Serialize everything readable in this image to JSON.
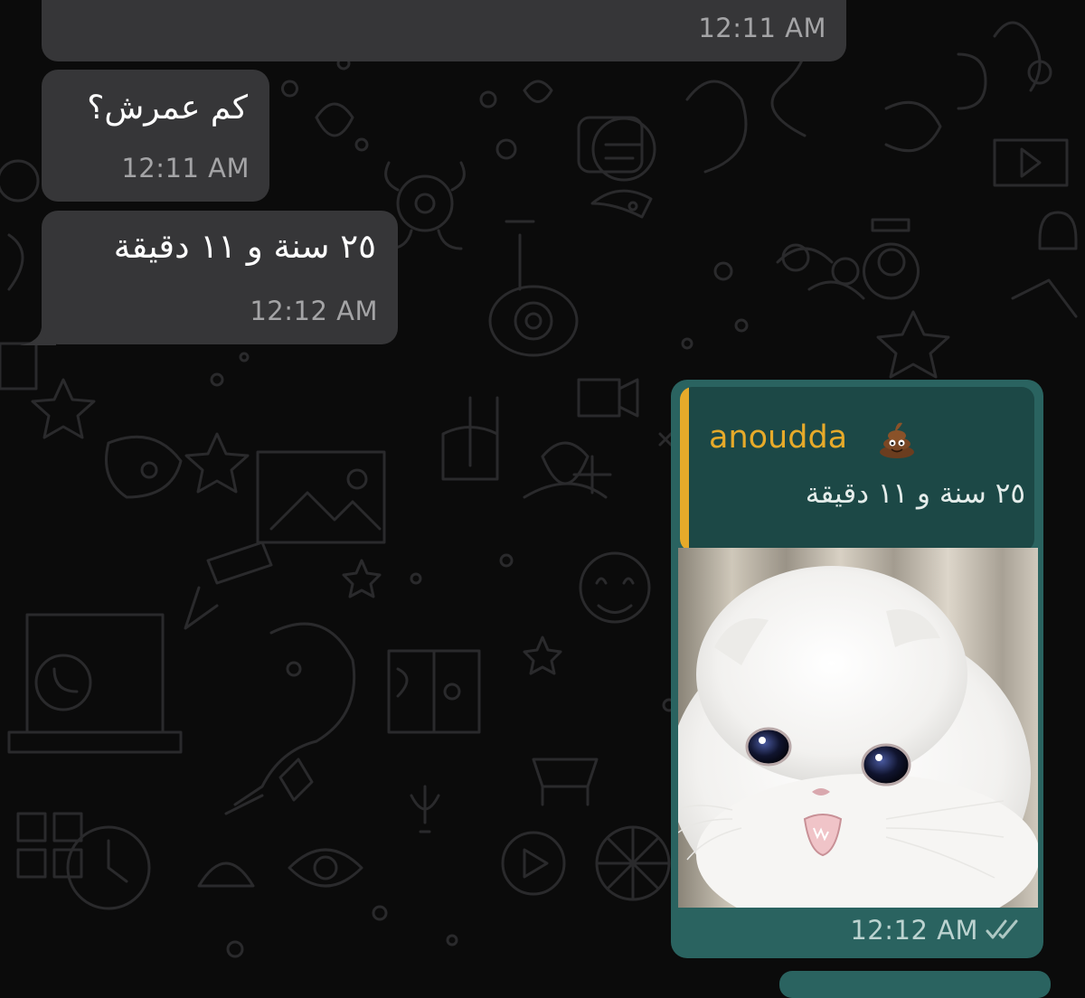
{
  "messages": [
    {
      "direction": "incoming",
      "text": "",
      "time": "12:11 AM"
    },
    {
      "direction": "incoming",
      "text": "كم عمرش؟",
      "time": "12:11 AM"
    },
    {
      "direction": "incoming",
      "text": "٢٥ سنة و ١١ دقيقة",
      "time": "12:12 AM"
    }
  ],
  "reply": {
    "quoted_author": "anoudda",
    "quoted_author_emoji": "pile-of-poo-icon",
    "quoted_text": "٢٥ سنة و ١١ دقيقة",
    "image": "crying-white-cat-photo",
    "time": "12:12 AM",
    "status": "read-double-check-icon"
  },
  "colors": {
    "wallpaper": "#0b0b0b",
    "incoming_bubble": "#363638",
    "outgoing_bubble": "#2a6360",
    "quote_background": "#1c4846",
    "quote_accent": "#e6aa2a",
    "timestamp": "#a4a4a6"
  }
}
